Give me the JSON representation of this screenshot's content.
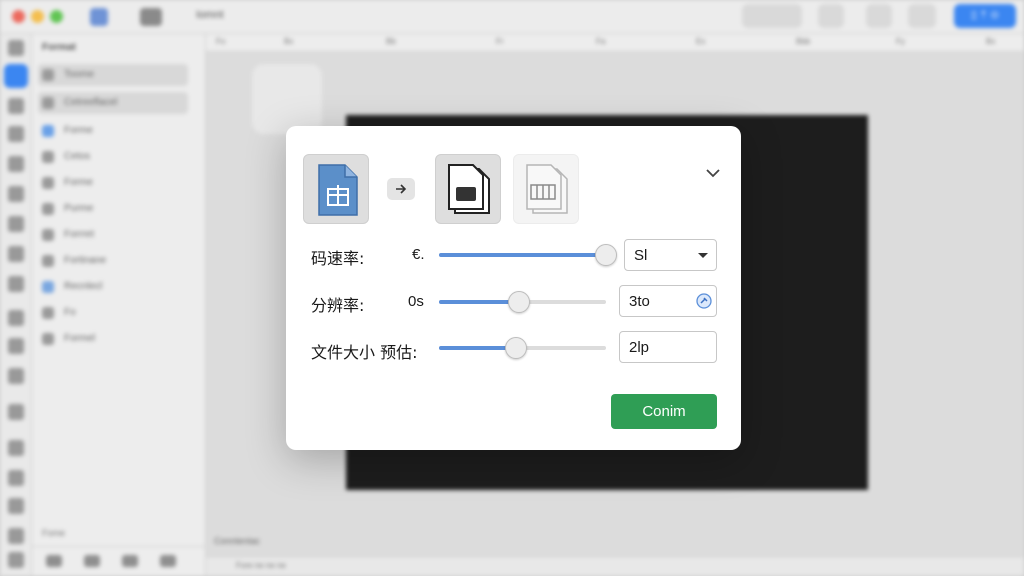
{
  "app": {
    "title": "Iomnt",
    "toolbar_share": "▯ ⇡ ⊙",
    "ruler_marks": [
      "Fo",
      "Bx",
      "Bb",
      "Fr",
      "Fa",
      "Ex",
      "Bbb",
      "Fy",
      "Bx"
    ],
    "sidebar": {
      "header": "Format",
      "items": [
        "Toome",
        "Cetreeflacel",
        "Forme",
        "Cetos",
        "Forme",
        "Purme",
        "Forrret",
        "Fortinane",
        "Recnlecl",
        "Fo",
        "Formel"
      ],
      "footer": "Fome"
    },
    "bottom_label": "Conntentac",
    "status_text": "Fore ne ne ne"
  },
  "dialog": {
    "rows": [
      {
        "label": "码速率:",
        "value": "€.",
        "slider_pct": 100,
        "field_value": "Sl",
        "field_type": "dropdown"
      },
      {
        "label": "分辨率:",
        "value": "0s",
        "slider_pct": 48,
        "field_value": "3to",
        "field_type": "picker"
      },
      {
        "label": "文件大小 预估:",
        "value": "",
        "slider_pct": 46,
        "field_value": "2lp",
        "field_type": "text"
      }
    ],
    "confirm_label": "Conim",
    "icons": {
      "source": "document-gift-icon",
      "arrow": "arrow-right-icon",
      "target": "document-stack-icon",
      "ghost": "document-grid-icon",
      "collapse": "chevron-down-icon"
    }
  },
  "colors": {
    "accent": "#3b86f1",
    "slider_fill": "#5b8fd9",
    "confirm": "#2f9e55",
    "source_doc": "#5b8fc9"
  }
}
